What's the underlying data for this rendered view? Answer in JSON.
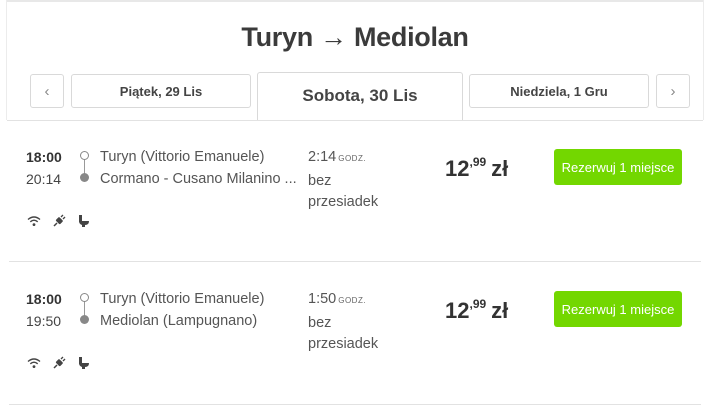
{
  "route": {
    "title": "Turyn → Mediolan"
  },
  "date_nav": {
    "prev_icon": "‹",
    "next_icon": "›",
    "tabs": [
      {
        "label": "Piątek, 29 Lis",
        "active": false
      },
      {
        "label": "Sobota, 30 Lis",
        "active": true
      },
      {
        "label": "Niedziela, 1 Gru",
        "active": false
      }
    ]
  },
  "trips": [
    {
      "departure_time": "18:00",
      "arrival_time": "20:14",
      "from_station": "Turyn (Vittorio Emanuele)",
      "to_station": "Cormano - Cusano Milanino ...",
      "duration": "2:14",
      "duration_unit": "GODZ.",
      "transfers": "bez przesiadek",
      "price_main": "12",
      "price_cents": ",99",
      "currency": "zł",
      "book_label": "Rezerwuj 1 miejsce",
      "amenities": [
        "wifi-icon",
        "power-plug-icon",
        "toilet-icon"
      ]
    },
    {
      "departure_time": "18:00",
      "arrival_time": "19:50",
      "from_station": "Turyn (Vittorio Emanuele)",
      "to_station": "Mediolan (Lampugnano)",
      "duration": "1:50",
      "duration_unit": "GODZ.",
      "transfers": "bez przesiadek",
      "price_main": "12",
      "price_cents": ",99",
      "currency": "zł",
      "book_label": "Rezerwuj 1 miejsce",
      "amenities": [
        "wifi-icon",
        "power-plug-icon",
        "toilet-icon"
      ]
    }
  ],
  "colors": {
    "accent": "#73d700",
    "text": "#333333"
  }
}
